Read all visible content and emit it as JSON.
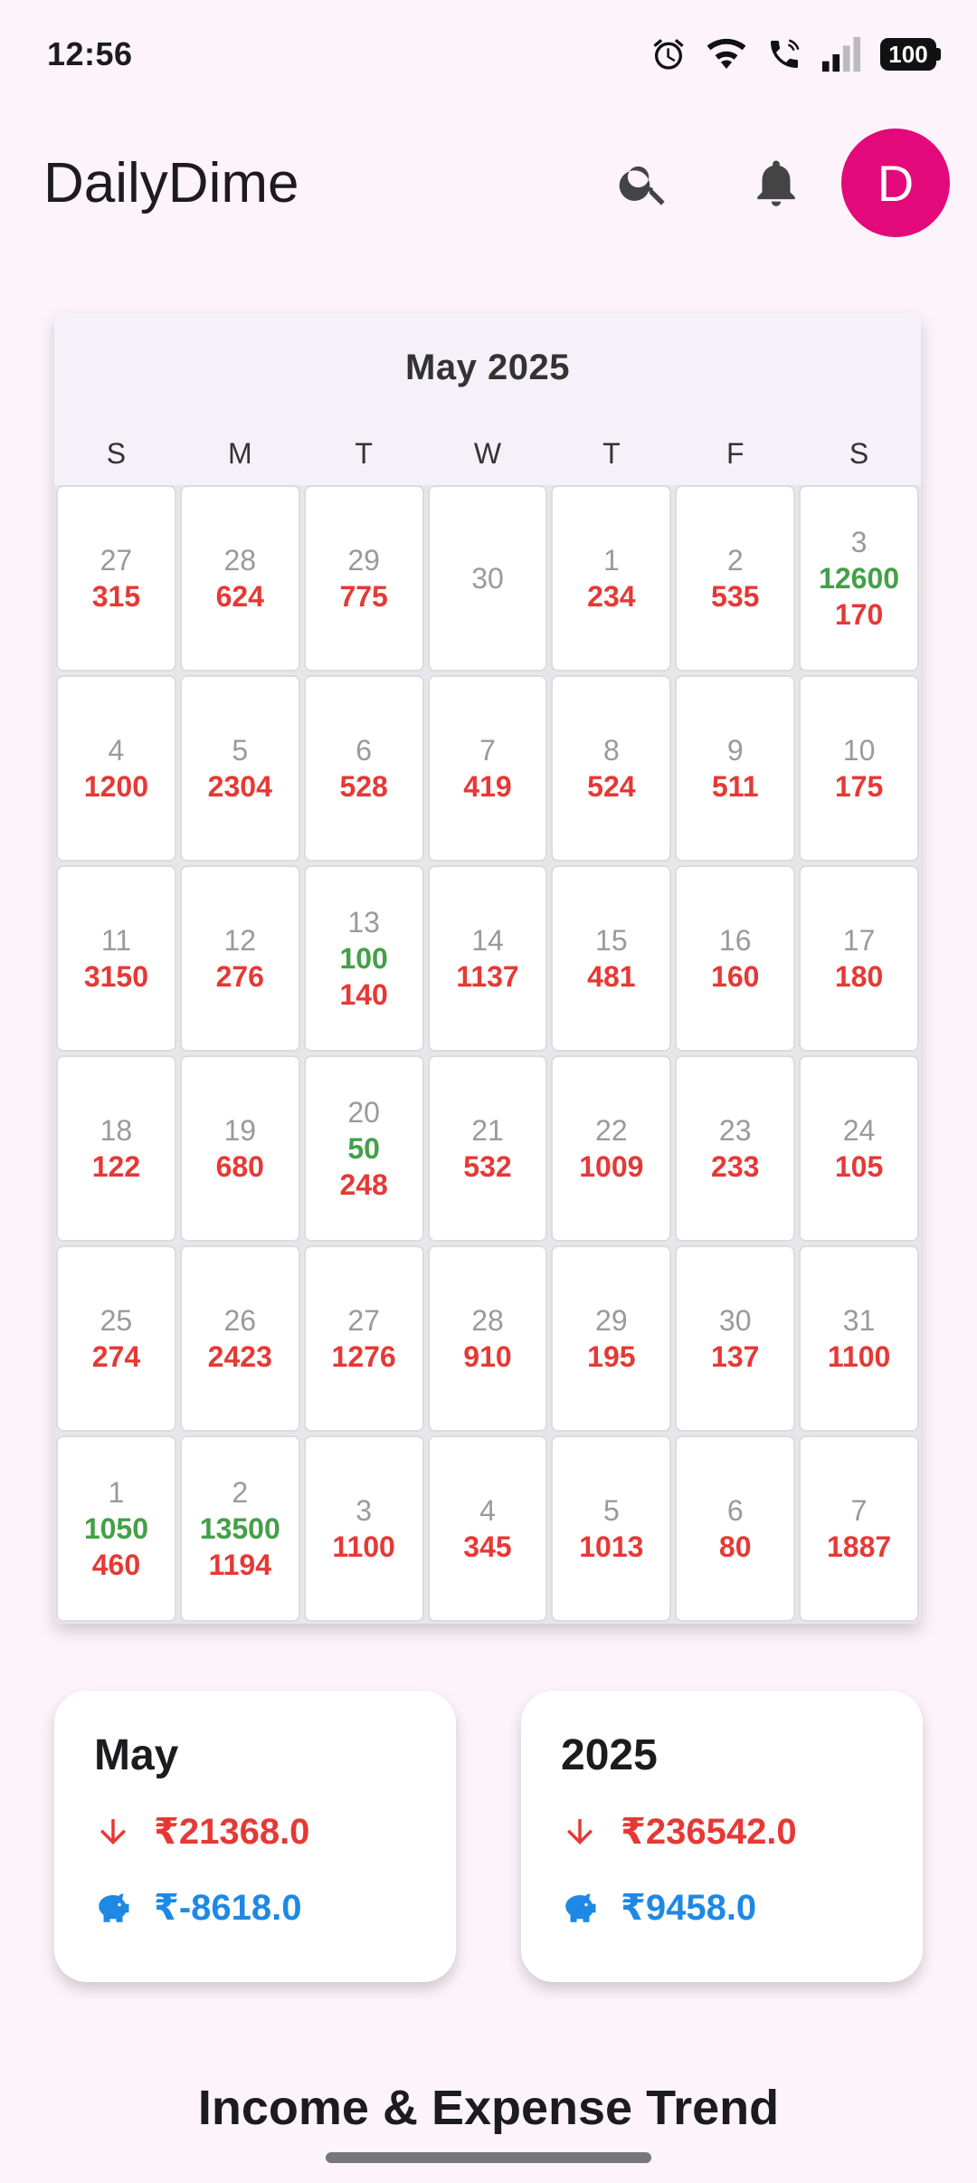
{
  "status_bar": {
    "time": "12:56",
    "battery": "100"
  },
  "app_bar": {
    "title": "DailyDime",
    "avatar_letter": "D"
  },
  "calendar": {
    "month_label": "May 2025",
    "weekdays": [
      "S",
      "M",
      "T",
      "W",
      "T",
      "F",
      "S"
    ],
    "weeks": [
      [
        {
          "day": "27",
          "expense": "315"
        },
        {
          "day": "28",
          "expense": "624"
        },
        {
          "day": "29",
          "expense": "775"
        },
        {
          "day": "30"
        },
        {
          "day": "1",
          "expense": "234"
        },
        {
          "day": "2",
          "expense": "535"
        },
        {
          "day": "3",
          "income": "12600",
          "expense": "170"
        }
      ],
      [
        {
          "day": "4",
          "expense": "1200"
        },
        {
          "day": "5",
          "expense": "2304"
        },
        {
          "day": "6",
          "expense": "528"
        },
        {
          "day": "7",
          "expense": "419"
        },
        {
          "day": "8",
          "expense": "524"
        },
        {
          "day": "9",
          "expense": "511"
        },
        {
          "day": "10",
          "expense": "175"
        }
      ],
      [
        {
          "day": "11",
          "expense": "3150"
        },
        {
          "day": "12",
          "expense": "276"
        },
        {
          "day": "13",
          "income": "100",
          "expense": "140"
        },
        {
          "day": "14",
          "expense": "1137"
        },
        {
          "day": "15",
          "expense": "481"
        },
        {
          "day": "16",
          "expense": "160"
        },
        {
          "day": "17",
          "expense": "180"
        }
      ],
      [
        {
          "day": "18",
          "expense": "122"
        },
        {
          "day": "19",
          "expense": "680"
        },
        {
          "day": "20",
          "income": "50",
          "expense": "248"
        },
        {
          "day": "21",
          "expense": "532"
        },
        {
          "day": "22",
          "expense": "1009"
        },
        {
          "day": "23",
          "expense": "233"
        },
        {
          "day": "24",
          "expense": "105"
        }
      ],
      [
        {
          "day": "25",
          "expense": "274"
        },
        {
          "day": "26",
          "expense": "2423"
        },
        {
          "day": "27",
          "expense": "1276"
        },
        {
          "day": "28",
          "expense": "910"
        },
        {
          "day": "29",
          "expense": "195"
        },
        {
          "day": "30",
          "expense": "137"
        },
        {
          "day": "31",
          "expense": "1100"
        }
      ],
      [
        {
          "day": "1",
          "income": "1050",
          "expense": "460"
        },
        {
          "day": "2",
          "income": "13500",
          "expense": "1194"
        },
        {
          "day": "3",
          "expense": "1100"
        },
        {
          "day": "4",
          "expense": "345"
        },
        {
          "day": "5",
          "expense": "1013"
        },
        {
          "day": "6",
          "expense": "80"
        },
        {
          "day": "7",
          "expense": "1887"
        }
      ]
    ]
  },
  "summary": {
    "month": {
      "title": "May",
      "expense": "₹21368.0",
      "savings": "₹-8618.0"
    },
    "year": {
      "title": "2025",
      "expense": "₹236542.0",
      "savings": "₹9458.0"
    }
  },
  "trend_title": "Income & Expense Trend",
  "colors": {
    "expense": "#e53935",
    "income": "#43a047",
    "savings": "#1e88e5",
    "avatar": "#e4097a"
  }
}
